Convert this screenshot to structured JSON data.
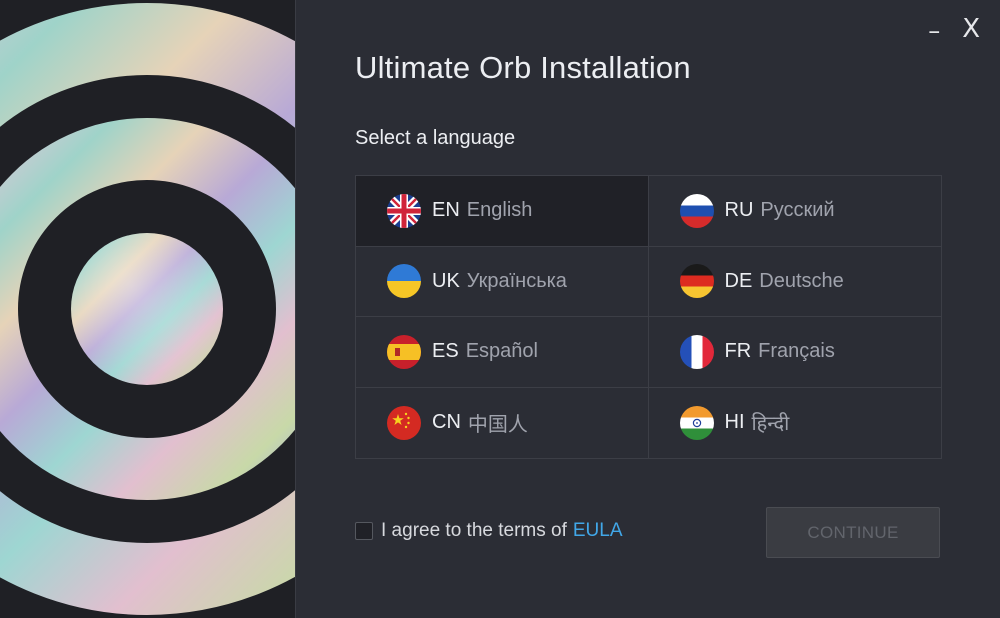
{
  "window": {
    "title": "Ultimate Orb Installation",
    "minimize_label": "–",
    "close_label": "X"
  },
  "language_section": {
    "heading": "Select a language",
    "selected": "EN",
    "languages": [
      {
        "code": "EN",
        "name": "English",
        "flag": "uk-flag-icon"
      },
      {
        "code": "RU",
        "name": "Русский",
        "flag": "russia-flag-icon"
      },
      {
        "code": "UK",
        "name": "Українська",
        "flag": "ukraine-flag-icon"
      },
      {
        "code": "DE",
        "name": "Deutsche",
        "flag": "germany-flag-icon"
      },
      {
        "code": "ES",
        "name": "Español",
        "flag": "spain-flag-icon"
      },
      {
        "code": "FR",
        "name": "Français",
        "flag": "france-flag-icon"
      },
      {
        "code": "CN",
        "name": "中国人",
        "flag": "china-flag-icon"
      },
      {
        "code": "HI",
        "name": "हिन्दी",
        "flag": "india-flag-icon"
      }
    ]
  },
  "agreement": {
    "text": "I agree to the terms of",
    "link": "EULA",
    "checked": false
  },
  "continue_button": {
    "label": "CONTINUE",
    "enabled": false
  },
  "colors": {
    "background": "#2b2d35",
    "art_panel": "#1f2025",
    "link": "#41a7e8",
    "selected_cell": "#202127"
  }
}
